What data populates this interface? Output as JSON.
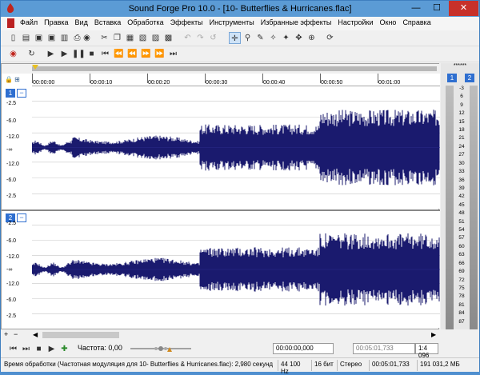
{
  "window": {
    "title": "Sound Forge Pro 10.0 - [10- Butterflies & Hurricanes.flac]",
    "minimize": "—",
    "maximize": "☐",
    "close": "✕"
  },
  "menu": [
    "Файл",
    "Правка",
    "Вид",
    "Вставка",
    "Обработка",
    "Эффекты",
    "Инструменты",
    "Избранные эффекты",
    "Настройки",
    "Окно",
    "Справка"
  ],
  "ruler": {
    "ticks": [
      "00:00:00",
      "00:00:10",
      "00:00:20",
      "00:00:30",
      "00:00:40",
      "00:00:50",
      "00:01:00"
    ]
  },
  "channels": [
    {
      "badge": "1",
      "db": [
        "-2.5",
        "-6.0",
        "-12.0",
        "-∞",
        "-12.0",
        "-6.0",
        "-2.5"
      ]
    },
    {
      "badge": "2",
      "db": [
        "-2.5",
        "-6.0",
        "-12.0",
        "-∞",
        "-12.0",
        "-6.0",
        "-2.5"
      ]
    }
  ],
  "transport": {
    "frequency": "Частота: 0,00",
    "time_start": "00:00:00,000",
    "time_end": "00:05:01,733",
    "zoom": "1:4 096"
  },
  "meter": {
    "header": "******",
    "badge1": "1",
    "badge2": "2",
    "scale": [
      "-3",
      "6",
      "9",
      "12",
      "15",
      "18",
      "21",
      "24",
      "27",
      "30",
      "33",
      "36",
      "39",
      "42",
      "45",
      "48",
      "51",
      "54",
      "57",
      "60",
      "63",
      "66",
      "69",
      "72",
      "75",
      "78",
      "81",
      "84",
      "87"
    ]
  },
  "status": {
    "text": "Время обработки (Частотная модуляция для 10- Butterflies & Hurricanes.flac): 2,980 секунд",
    "rate": "44 100 Hz",
    "bits": "16 бит",
    "mode": "Стерео",
    "length": "00:05:01,733",
    "size": "191 031,2 МБ"
  },
  "colors": {
    "waveform": "#1a1a6e",
    "accent": "#2f6fd0",
    "titlebar": "#5b9bd5"
  }
}
